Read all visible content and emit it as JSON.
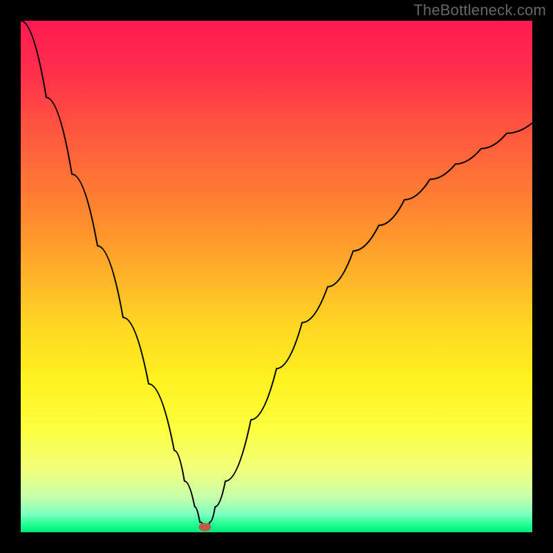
{
  "watermark": "TheBottleneck.com",
  "chart_data": {
    "type": "line",
    "title": "",
    "xlabel": "",
    "ylabel": "",
    "xlim": [
      0,
      100
    ],
    "ylim": [
      0,
      100
    ],
    "series": [
      {
        "name": "bottleneck-curve",
        "x": [
          0,
          5,
          10,
          15,
          20,
          25,
          30,
          32,
          34,
          35,
          36,
          37,
          38,
          40,
          45,
          50,
          55,
          60,
          65,
          70,
          75,
          80,
          85,
          90,
          95,
          100
        ],
        "values": [
          100,
          85,
          70,
          56,
          42,
          29,
          16,
          10,
          5,
          2,
          1,
          2,
          5,
          10,
          22,
          32,
          41,
          48,
          55,
          60,
          65,
          69,
          72,
          75,
          78,
          80
        ],
        "stroke": "#000000",
        "stroke_width": 2
      }
    ],
    "marker": {
      "name": "optimal-point",
      "x": 36,
      "y": 1,
      "color": "#c05a4a",
      "rx": 9,
      "ry": 6
    },
    "background_gradient": {
      "type": "vertical",
      "stops": [
        {
          "y": 0.0,
          "color": "#ff1a52"
        },
        {
          "y": 0.1,
          "color": "#ff2f4b"
        },
        {
          "y": 0.2,
          "color": "#ff5140"
        },
        {
          "y": 0.3,
          "color": "#ff7037"
        },
        {
          "y": 0.4,
          "color": "#ff8f2e"
        },
        {
          "y": 0.5,
          "color": "#ffb328"
        },
        {
          "y": 0.6,
          "color": "#ffd822"
        },
        {
          "y": 0.7,
          "color": "#fff120"
        },
        {
          "y": 0.8,
          "color": "#fcff3e"
        },
        {
          "y": 0.88,
          "color": "#f0ff7e"
        },
        {
          "y": 0.93,
          "color": "#c8ffaa"
        },
        {
          "y": 0.965,
          "color": "#7effc0"
        },
        {
          "y": 0.985,
          "color": "#1eff90"
        },
        {
          "y": 1.0,
          "color": "#00e876"
        }
      ]
    }
  }
}
